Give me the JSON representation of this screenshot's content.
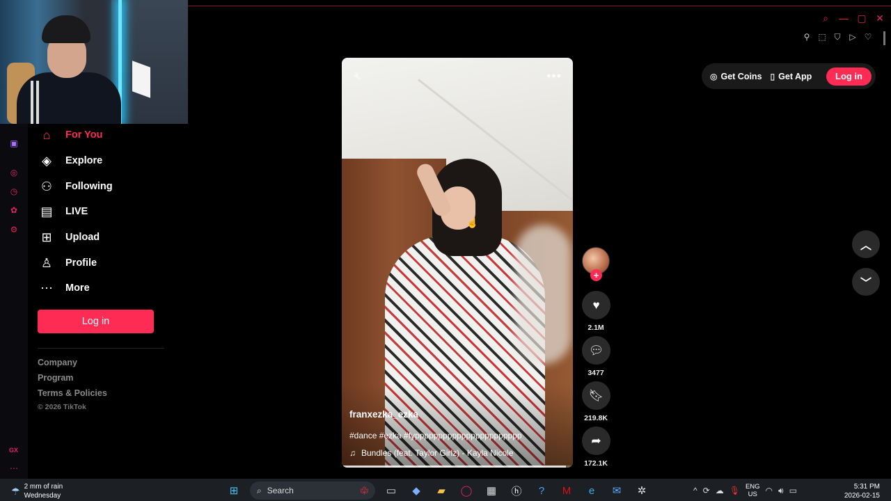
{
  "sidebar": {
    "items": [
      {
        "label": "For You",
        "icon": "home-icon"
      },
      {
        "label": "Explore",
        "icon": "compass-icon"
      },
      {
        "label": "Following",
        "icon": "following-icon"
      },
      {
        "label": "LIVE",
        "icon": "live-icon"
      },
      {
        "label": "Upload",
        "icon": "upload-icon"
      },
      {
        "label": "Profile",
        "icon": "person-icon"
      },
      {
        "label": "More",
        "icon": "more-icon"
      }
    ],
    "login_label": "Log in",
    "footer": {
      "company": "Company",
      "program": "Program",
      "terms": "Terms & Policies",
      "copyright": "© 2026 TikTok"
    }
  },
  "header": {
    "get_coins": "Get Coins",
    "get_app": "Get App",
    "login_label": "Log in"
  },
  "video": {
    "author": "franxezka_ezka",
    "caption": "#dance #ezka #fyppppppppppppppppppppppp",
    "music": "Bundles (feat. Taylor Girlz) - Kayla Nicole",
    "progress": 0.97
  },
  "actions": {
    "likes": "2.1M",
    "comments": "3477",
    "saves": "219.8K",
    "shares": "172.1K"
  },
  "browser": {
    "gx_label": "GX"
  },
  "taskbar": {
    "weather_line1": "2 mm of rain",
    "weather_line2": "Wednesday",
    "search_label": "Search",
    "lang_line1": "ENG",
    "lang_line2": "US",
    "time": "5:31 PM",
    "date": "2026-02-15"
  },
  "colors": {
    "accent": "#fe2c55",
    "opera_gx": "#e0245e"
  }
}
